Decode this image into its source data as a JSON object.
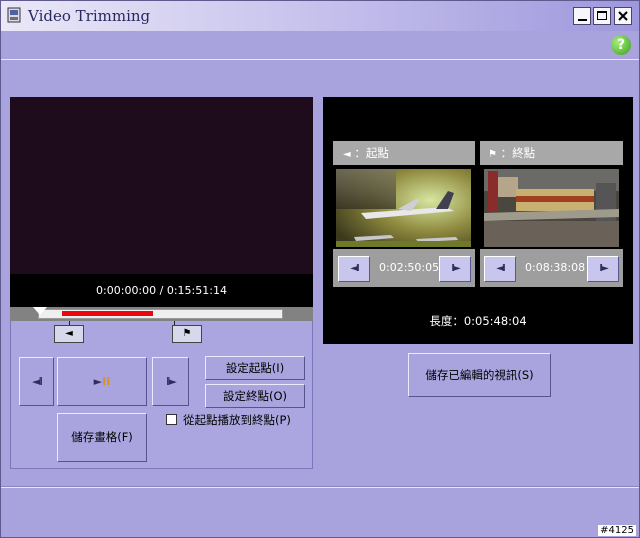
{
  "window": {
    "title": "Video Trimming",
    "controls": {
      "minimize": "_",
      "maximize": "□",
      "close": "✕"
    },
    "help_glyph": "?"
  },
  "player": {
    "time_display": "0:00:00:00 / 0:15:51:14",
    "trim_start_fraction": 0.0,
    "trim_end_fraction": 0.37,
    "start_flag_glyph": "◄",
    "end_flag_glyph": "⚑"
  },
  "playback": {
    "prev_frame_label": "◄II",
    "play_pause_label": "►II",
    "next_frame_label": "II►"
  },
  "buttons": {
    "set_start": "設定起點(I)",
    "set_end": "設定終點(O)",
    "save_frame": "儲存畫格(F)",
    "save_video": "儲存已編輯的視訊(S)"
  },
  "checkbox": {
    "label": "從起點播放到終點(P)",
    "checked": false
  },
  "preview": {
    "start": {
      "caption": "：起點",
      "time": "0:02:50:05"
    },
    "end": {
      "caption": "：終點",
      "time": "0:08:38:08"
    },
    "length": "長度：0:05:48:04"
  },
  "corner_tag": "#4125",
  "colors": {
    "window_bg": "#a9a3dd",
    "accent_red": "#e8080e",
    "help_green": "#3a9c1b"
  }
}
